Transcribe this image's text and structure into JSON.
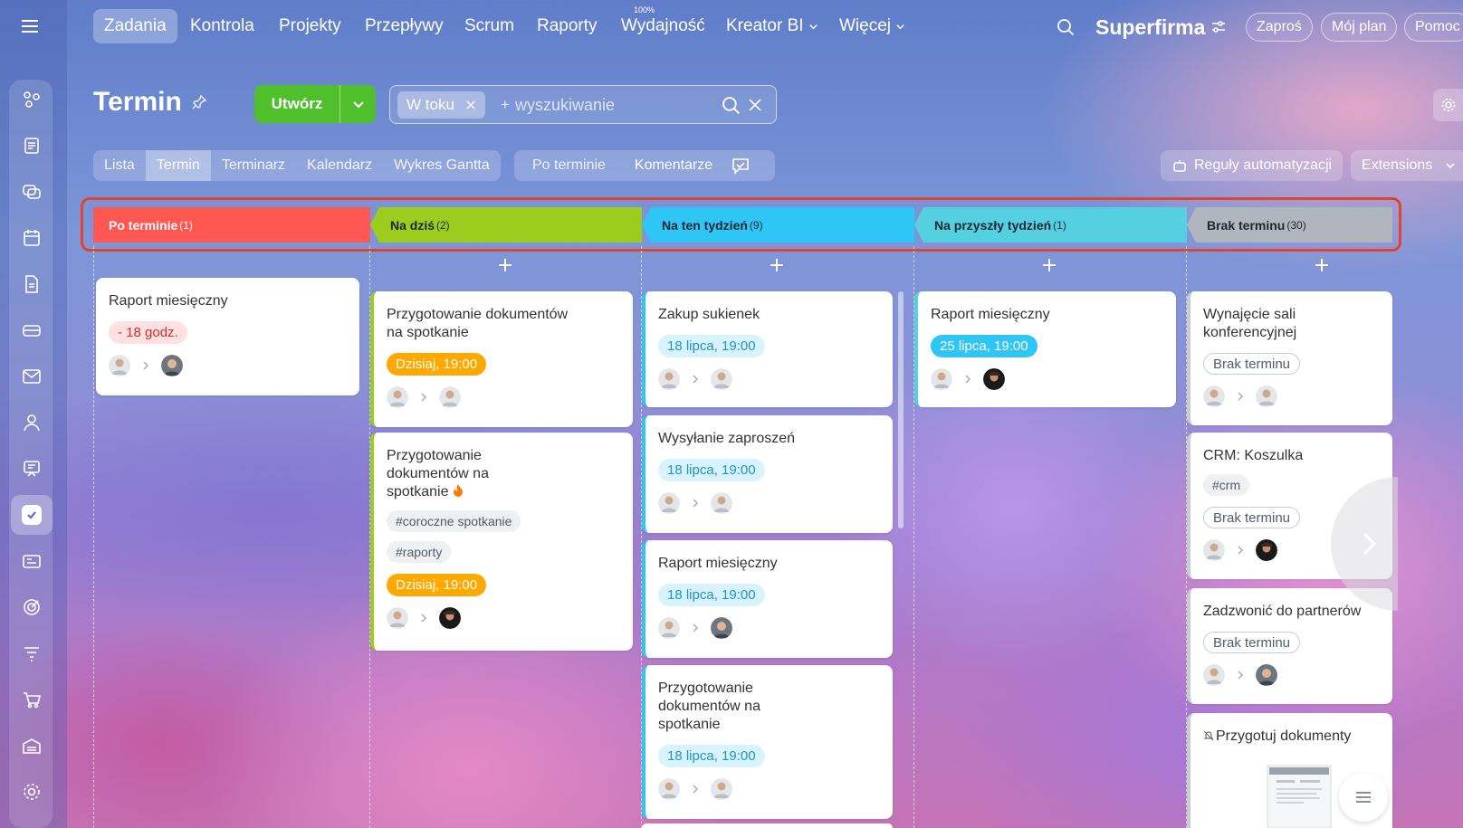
{
  "nav": {
    "items": [
      {
        "label": "Zadania"
      },
      {
        "label": "Kontrola"
      },
      {
        "label": "Projekty"
      },
      {
        "label": "Przepływy"
      },
      {
        "label": "Scrum"
      },
      {
        "label": "Raporty"
      },
      {
        "label": "Wydajność"
      },
      {
        "label": "Kreator BI"
      },
      {
        "label": "Więcej"
      }
    ],
    "efficiency_badge": "100%",
    "brand": "Superfirma",
    "buttons": {
      "invite": "Zaproś",
      "my_plan": "Mój plan",
      "help": "Pomoc"
    }
  },
  "page": {
    "title": "Termin",
    "create_label": "Utwórz",
    "search": {
      "chip": "W toku",
      "plus": "+",
      "placeholder": "wyszukiwanie"
    }
  },
  "view_tabs": [
    "Lista",
    "Termin",
    "Terminarz",
    "Kalendarz",
    "Wykres Gantta"
  ],
  "sub_tabs": [
    "Po terminie",
    "Komentarze"
  ],
  "automation_label": "Reguły automatyzacji",
  "extensions_label": "Extensions",
  "stages": [
    {
      "label": "Po terminie",
      "count": "(1)",
      "color": "#ff5752"
    },
    {
      "label": "Na dziś",
      "count": "(2)",
      "color": "#9ccc1d"
    },
    {
      "label": "Na ten tydzień",
      "count": "(9)",
      "color": "#2fc6f6"
    },
    {
      "label": "Na przyszły tydzień",
      "count": "(1)",
      "color": "#55d0e0"
    },
    {
      "label": "Brak terminu",
      "count": "(30)",
      "color": "#b0b6bd"
    }
  ],
  "cards": {
    "c1": {
      "title": "Raport miesięczny",
      "deadline": "- 18 godz."
    },
    "c2": {
      "title": "Przygotowanie dokumentów na spotkanie",
      "deadline": "Dzisiaj, 19:00"
    },
    "c3": {
      "title": "Przygotowanie dokumentów na spotkanie",
      "tags": [
        "#coroczne spotkanie",
        "#raporty"
      ],
      "deadline": "Dzisiaj, 19:00"
    },
    "c4": {
      "title": "Zakup sukienek",
      "deadline": "18 lipca, 19:00"
    },
    "c5": {
      "title": "Wysyłanie zaproszeń",
      "deadline": "18 lipca, 19:00"
    },
    "c6": {
      "title": "Raport miesięczny",
      "deadline": "18 lipca, 19:00"
    },
    "c7": {
      "title": "Przygotowanie dokumentów na spotkanie",
      "deadline": "18 lipca, 19:00"
    },
    "c8": {
      "title": "Raport miesięczny",
      "deadline": "25 lipca, 19:00"
    },
    "c9": {
      "title": "Wynajęcie sali konferencyjnej",
      "deadline": "Brak terminu"
    },
    "c10": {
      "title": "CRM: Koszulka",
      "tags": [
        "#crm"
      ],
      "deadline": "Brak terminu"
    },
    "c11": {
      "title": "Zadzwonić do partnerów",
      "deadline": "Brak terminu"
    },
    "c12": {
      "title": "Przygotuj dokumenty"
    }
  }
}
